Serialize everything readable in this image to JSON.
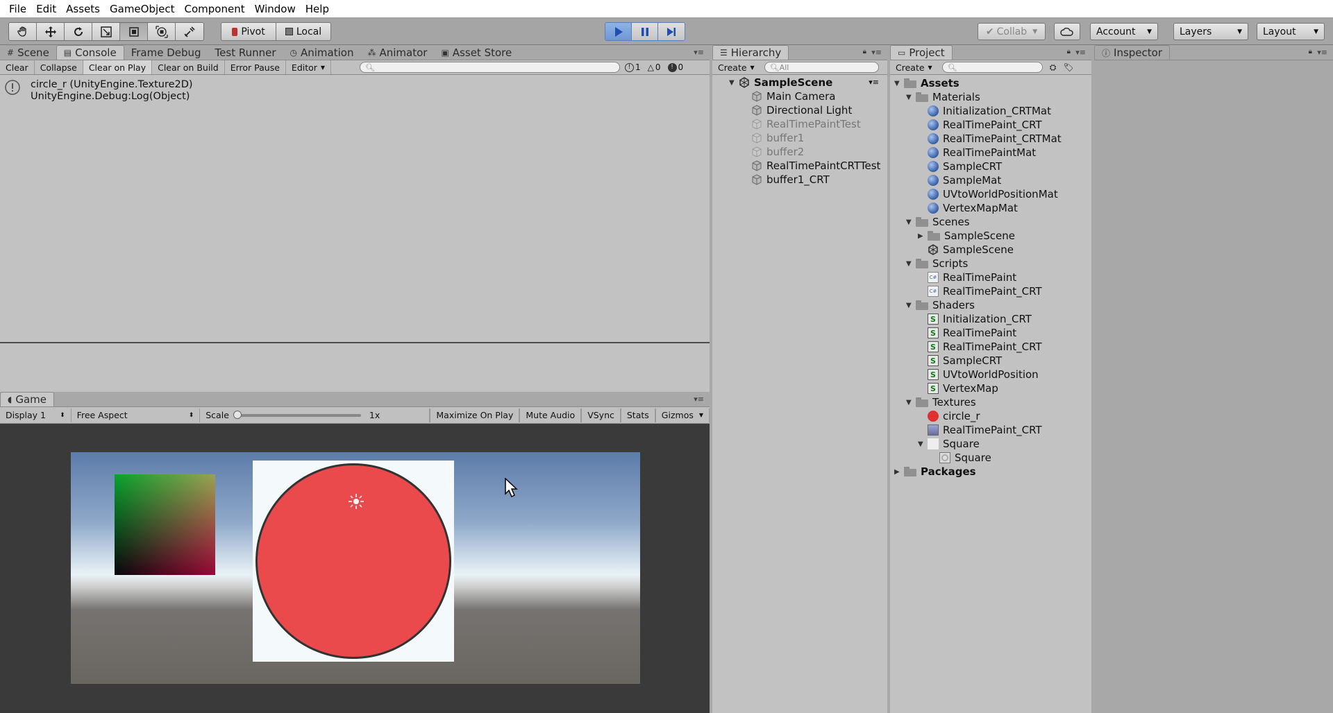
{
  "menubar": [
    "File",
    "Edit",
    "Assets",
    "GameObject",
    "Component",
    "Window",
    "Help"
  ],
  "toolbar": {
    "pivot": "Pivot",
    "local": "Local",
    "collab": "Collab",
    "account": "Account",
    "layers": "Layers",
    "layout": "Layout"
  },
  "console_panel": {
    "tabs": [
      "Scene",
      "Console",
      "Frame Debug",
      "Test Runner",
      "Animation",
      "Animator",
      "Asset Store"
    ],
    "toolbar": [
      "Clear",
      "Collapse",
      "Clear on Play",
      "Clear on Build",
      "Error Pause",
      "Editor"
    ],
    "counts": {
      "info": "1",
      "warning": "0",
      "error": "0"
    },
    "log": {
      "line1": "circle_r (UnityEngine.Texture2D)",
      "line2": "UnityEngine.Debug:Log(Object)"
    }
  },
  "game_panel": {
    "tab": "Game",
    "display": "Display 1",
    "aspect": "Free Aspect",
    "scale_label": "Scale",
    "scale_value": "1x",
    "toggles": [
      "Maximize On Play",
      "Mute Audio",
      "VSync",
      "Stats",
      "Gizmos"
    ]
  },
  "hierarchy": {
    "tab": "Hierarchy",
    "create": "Create",
    "search_placeholder": "All",
    "scene": "SampleScene",
    "items": [
      {
        "label": "Main Camera",
        "dim": false
      },
      {
        "label": "Directional Light",
        "dim": false
      },
      {
        "label": "RealTimePaintTest",
        "dim": true
      },
      {
        "label": "buffer1",
        "dim": true
      },
      {
        "label": "buffer2",
        "dim": true
      },
      {
        "label": "RealTimePaintCRTTest",
        "dim": false
      },
      {
        "label": "buffer1_CRT",
        "dim": false
      }
    ]
  },
  "project": {
    "tab": "Project",
    "create": "Create",
    "tree": [
      {
        "label": "Assets",
        "depth": 0,
        "icon": "folder-icon",
        "arrow": "down",
        "bold": true
      },
      {
        "label": "Materials",
        "depth": 1,
        "icon": "folder-icon",
        "arrow": "down"
      },
      {
        "label": "Initialization_CRTMat",
        "depth": 2,
        "icon": "material-icon"
      },
      {
        "label": "RealTimePaint_CRT",
        "depth": 2,
        "icon": "material-icon"
      },
      {
        "label": "RealTimePaint_CRTMat",
        "depth": 2,
        "icon": "material-icon"
      },
      {
        "label": "RealTimePaintMat",
        "depth": 2,
        "icon": "material-icon"
      },
      {
        "label": "SampleCRT",
        "depth": 2,
        "icon": "material-icon"
      },
      {
        "label": "SampleMat",
        "depth": 2,
        "icon": "material-icon"
      },
      {
        "label": "UVtoWorldPositionMat",
        "depth": 2,
        "icon": "material-icon"
      },
      {
        "label": "VertexMapMat",
        "depth": 2,
        "icon": "material-icon"
      },
      {
        "label": "Scenes",
        "depth": 1,
        "icon": "folder-icon",
        "arrow": "down"
      },
      {
        "label": "SampleScene",
        "depth": 2,
        "icon": "folder-icon",
        "arrow": "right"
      },
      {
        "label": "SampleScene",
        "depth": 2,
        "icon": "unity-scene-icon"
      },
      {
        "label": "Scripts",
        "depth": 1,
        "icon": "folder-icon",
        "arrow": "down"
      },
      {
        "label": "RealTimePaint",
        "depth": 2,
        "icon": "script-icon"
      },
      {
        "label": "RealTimePaint_CRT",
        "depth": 2,
        "icon": "script-icon"
      },
      {
        "label": "Shaders",
        "depth": 1,
        "icon": "folder-icon",
        "arrow": "down"
      },
      {
        "label": "Initialization_CRT",
        "depth": 2,
        "icon": "shader-icon"
      },
      {
        "label": "RealTimePaint",
        "depth": 2,
        "icon": "shader-icon"
      },
      {
        "label": "RealTimePaint_CRT",
        "depth": 2,
        "icon": "shader-icon"
      },
      {
        "label": "SampleCRT",
        "depth": 2,
        "icon": "shader-icon"
      },
      {
        "label": "UVtoWorldPosition",
        "depth": 2,
        "icon": "shader-icon"
      },
      {
        "label": "VertexMap",
        "depth": 2,
        "icon": "shader-icon"
      },
      {
        "label": "Textures",
        "depth": 1,
        "icon": "folder-icon",
        "arrow": "down"
      },
      {
        "label": "circle_r",
        "depth": 2,
        "icon": "red-circle-texture-icon"
      },
      {
        "label": "RealTimePaint_CRT",
        "depth": 2,
        "icon": "render-texture-icon"
      },
      {
        "label": "Square",
        "depth": 2,
        "icon": "white-texture-icon",
        "arrow": "down"
      },
      {
        "label": "Square",
        "depth": 3,
        "icon": "sprite-icon"
      },
      {
        "label": "Packages",
        "depth": 0,
        "icon": "folder-icon",
        "arrow": "right",
        "bold": true
      }
    ]
  },
  "inspector": {
    "tab": "Inspector"
  }
}
